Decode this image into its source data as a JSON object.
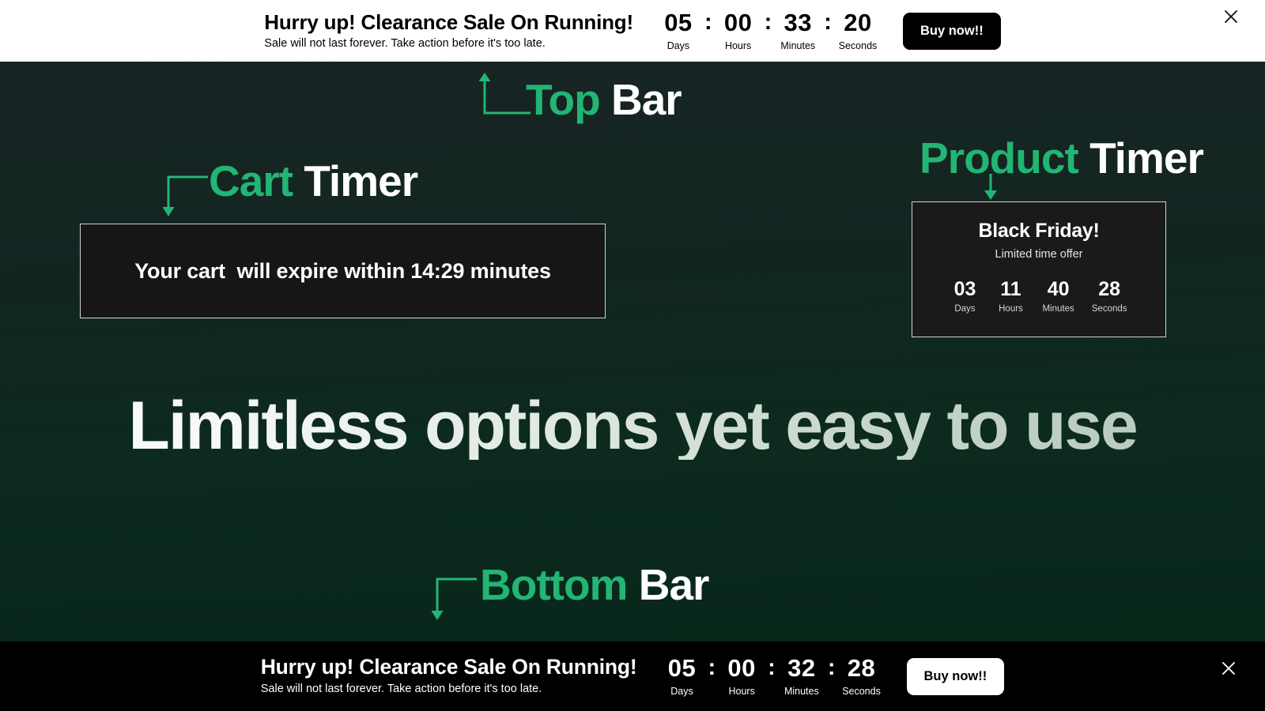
{
  "top_bar": {
    "title": "Hurry up! Clearance Sale On Running!",
    "subtitle": "Sale will not last forever. Take action before it's too late.",
    "countdown": {
      "days": "05",
      "hours": "00",
      "minutes": "33",
      "seconds": "20",
      "labels": {
        "days": "Days",
        "hours": "Hours",
        "minutes": "Minutes",
        "seconds": "Seconds"
      },
      "separator": ":"
    },
    "cta_label": "Buy now!!",
    "close_icon": "close-icon",
    "background_color": "#ffffff",
    "text_color": "#000000"
  },
  "bottom_bar": {
    "title": "Hurry up! Clearance Sale On Running!",
    "subtitle": "Sale will not last forever. Take action before it's too late.",
    "countdown": {
      "days": "05",
      "hours": "00",
      "minutes": "32",
      "seconds": "28",
      "labels": {
        "days": "Days",
        "hours": "Hours",
        "minutes": "Minutes",
        "seconds": "Seconds"
      },
      "separator": ":"
    },
    "cta_label": "Buy now!!",
    "close_icon": "close-icon",
    "background_color": "#000000",
    "text_color": "#ffffff"
  },
  "annotations": {
    "top_bar": {
      "accent_word": "Top",
      "plain_word": "Bar",
      "arrow_icon": "arrow-up-left-elbow-icon"
    },
    "cart_timer": {
      "accent_word": "Cart",
      "plain_word": "Timer",
      "arrow_icon": "arrow-down-left-elbow-icon"
    },
    "product_timer": {
      "accent_word": "Product",
      "plain_word": "Timer",
      "arrow_icon": "arrow-down-icon"
    },
    "bottom_bar": {
      "accent_word": "Bottom",
      "plain_word": "Bar",
      "arrow_icon": "arrow-down-left-elbow-icon"
    }
  },
  "cart_timer": {
    "message": "Your cart  will expire within 14:29 minutes",
    "background_color": "#161616",
    "border_color": "#cfd4d2"
  },
  "product_timer": {
    "title": "Black Friday!",
    "subtitle": "Limited time offer",
    "countdown": {
      "days": "03",
      "hours": "11",
      "minutes": "40",
      "seconds": "28",
      "labels": {
        "days": "Days",
        "hours": "Hours",
        "minutes": "Minutes",
        "seconds": "Seconds"
      }
    },
    "background_color": "#1a1a1a",
    "border_color": "#cfd4d2"
  },
  "hero": {
    "headline": "Limitless options yet easy to use"
  },
  "theme": {
    "accent_green": "#22b573",
    "page_background_top": "#1b2427",
    "page_background_bottom": "#062719"
  }
}
